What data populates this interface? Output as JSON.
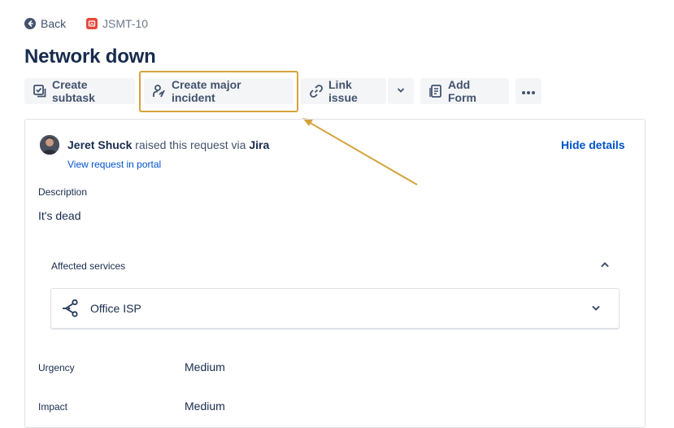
{
  "nav": {
    "back_label": "Back",
    "issue_key": "JSMT-10"
  },
  "issue": {
    "title": "Network down"
  },
  "toolbar": {
    "create_subtask": "Create subtask",
    "create_major_incident": "Create major incident",
    "link_issue": "Link issue",
    "add_form": "Add Form"
  },
  "request": {
    "reporter": "Jeret Shuck",
    "raised_text": "raised this request via",
    "channel": "Jira",
    "portal_link": "View request in portal",
    "hide_details": "Hide details"
  },
  "description": {
    "label": "Description",
    "value": "It's dead"
  },
  "affected_services": {
    "label": "Affected services",
    "items": [
      "Office ISP"
    ]
  },
  "fields": [
    {
      "label": "Urgency",
      "value": "Medium"
    },
    {
      "label": "Impact",
      "value": "Medium"
    }
  ],
  "colors": {
    "highlight": "#d4a33b",
    "link": "#0052cc",
    "issue_icon": "#e5493a"
  }
}
